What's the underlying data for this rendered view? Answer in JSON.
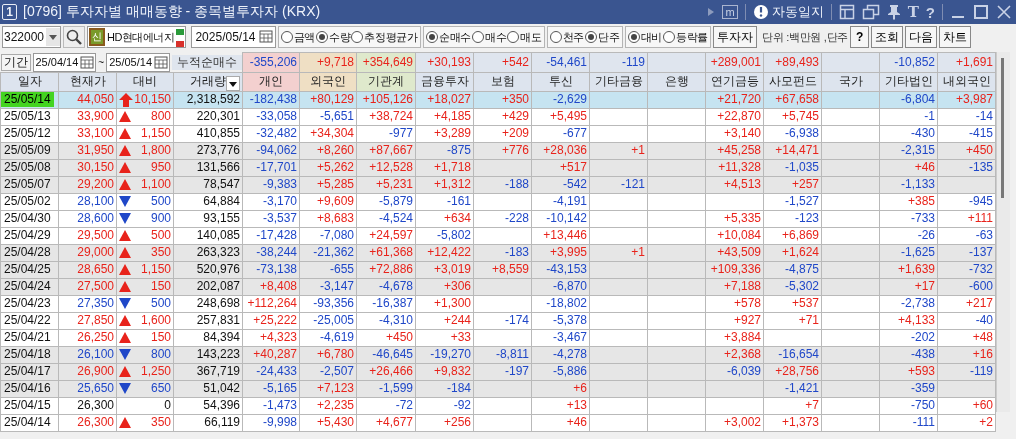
{
  "window": {
    "badge": "1",
    "title": "[0796] 투자자별 매매동향 - 종목별투자자 (KRX)",
    "auto_log": "자동일지",
    "glyphs": [
      "m",
      "T",
      "?"
    ]
  },
  "toolbar": {
    "code": "322000",
    "badge": "신",
    "stock_name": "HD현대에너지",
    "date": "2025/05/14",
    "radio_groups": [
      [
        {
          "label": "금액",
          "selected": false
        },
        {
          "label": "수량",
          "selected": true
        },
        {
          "label": "추정평균가",
          "selected": false
        }
      ],
      [
        {
          "label": "순매수",
          "selected": true
        },
        {
          "label": "매수",
          "selected": false
        },
        {
          "label": "매도",
          "selected": false
        }
      ],
      [
        {
          "label": "천주",
          "selected": false
        },
        {
          "label": "단주",
          "selected": true
        }
      ],
      [
        {
          "label": "대비",
          "selected": true
        },
        {
          "label": "등락률",
          "selected": false
        }
      ]
    ],
    "investor_button": "투자자",
    "unit": "단위 :백만원 ,단주",
    "buttons": [
      "?",
      "조회",
      "다음",
      "차트"
    ]
  },
  "period": {
    "label": "기간",
    "from": "25/04/14",
    "sep": "~",
    "to": "25/05/14",
    "total_label": "누적순매수",
    "totals": {
      "individual": "-355,206",
      "foreign": "+9,718",
      "institutional": "+354,649",
      "fin_invest": "+30,193",
      "insurance": "+542",
      "trust": "-54,461",
      "other_fin": "-119",
      "pension": "+289,001",
      "private_fund": "+89,493",
      "other_corp": "-10,852",
      "other_foreign": "+1,691"
    }
  },
  "table": {
    "columns": [
      {
        "label": "일자",
        "menu": false
      },
      {
        "label": "현재가",
        "menu": false
      },
      {
        "label": "대비",
        "menu": false
      },
      {
        "label": "거래량",
        "menu": true
      },
      {
        "label": "개인",
        "menu": false,
        "color": "#f3d0cf"
      },
      {
        "label": "외국인",
        "menu": false,
        "color": "#efdfc4"
      },
      {
        "label": "기관계",
        "menu": false,
        "color": "#dfe9cc"
      },
      {
        "label": "금융투자",
        "menu": false
      },
      {
        "label": "보험",
        "menu": false
      },
      {
        "label": "투신",
        "menu": false
      },
      {
        "label": "기타금융",
        "menu": false
      },
      {
        "label": "은행",
        "menu": false
      },
      {
        "label": "연기금등",
        "menu": false
      },
      {
        "label": "사모펀드",
        "menu": false
      },
      {
        "label": "국가",
        "menu": false
      },
      {
        "label": "기타법인",
        "menu": false
      },
      {
        "label": "내외국인",
        "menu": false
      }
    ],
    "rows": [
      {
        "selected": true,
        "shaded": false,
        "date": "25/05/14",
        "price": "44,050",
        "kind": "upper",
        "change": "10,150",
        "volume": "2,318,592",
        "individual": "-182,438",
        "foreign": "+80,129",
        "institutional": "+105,126",
        "fin_invest": "+18,027",
        "insurance": "+350",
        "trust": "-2,629",
        "pension": "+21,720",
        "private_fund": "+67,658",
        "other_corp": "-6,804",
        "other_foreign": "+3,987"
      },
      {
        "selected": false,
        "shaded": false,
        "date": "25/05/13",
        "price": "33,900",
        "kind": "up",
        "change": "800",
        "volume": "220,301",
        "individual": "-33,058",
        "foreign": "-5,651",
        "institutional": "+38,724",
        "fin_invest": "+4,185",
        "insurance": "+429",
        "trust": "+5,495",
        "pension": "+22,870",
        "private_fund": "+5,745",
        "other_corp": "-1",
        "other_foreign": "-14"
      },
      {
        "selected": false,
        "shaded": false,
        "date": "25/05/12",
        "price": "33,100",
        "kind": "up",
        "change": "1,150",
        "volume": "410,855",
        "individual": "-32,482",
        "foreign": "+34,304",
        "institutional": "-977",
        "fin_invest": "+3,289",
        "insurance": "+209",
        "trust": "-677",
        "pension": "+3,140",
        "private_fund": "-6,938",
        "other_corp": "-430",
        "other_foreign": "-415"
      },
      {
        "selected": false,
        "shaded": true,
        "date": "25/05/09",
        "price": "31,950",
        "kind": "up",
        "change": "1,800",
        "volume": "273,776",
        "individual": "-94,062",
        "foreign": "+8,260",
        "institutional": "+87,667",
        "fin_invest": "-875",
        "insurance": "+776",
        "trust": "+28,036",
        "other_fin": "+1",
        "pension": "+45,258",
        "private_fund": "+14,471",
        "other_corp": "-2,315",
        "other_foreign": "+450"
      },
      {
        "selected": false,
        "shaded": true,
        "date": "25/05/08",
        "price": "30,150",
        "kind": "up",
        "change": "950",
        "volume": "131,566",
        "individual": "-17,701",
        "foreign": "+5,262",
        "institutional": "+12,528",
        "fin_invest": "+1,718",
        "trust": "+517",
        "pension": "+11,328",
        "private_fund": "-1,035",
        "other_corp": "+46",
        "other_foreign": "-135"
      },
      {
        "selected": false,
        "shaded": true,
        "date": "25/05/07",
        "price": "29,200",
        "kind": "up",
        "change": "1,100",
        "volume": "78,547",
        "individual": "-9,383",
        "foreign": "+5,285",
        "institutional": "+5,231",
        "fin_invest": "+1,312",
        "insurance": "-188",
        "trust": "-542",
        "other_fin": "-121",
        "pension": "+4,513",
        "private_fund": "+257",
        "other_corp": "-1,133"
      },
      {
        "selected": false,
        "shaded": false,
        "date": "25/05/02",
        "price": "28,100",
        "kind": "down",
        "change": "500",
        "volume": "64,884",
        "individual": "-3,170",
        "foreign": "+9,609",
        "institutional": "-5,879",
        "fin_invest": "-161",
        "trust": "-4,191",
        "private_fund": "-1,527",
        "other_corp": "+385",
        "other_foreign": "-945"
      },
      {
        "selected": false,
        "shaded": false,
        "date": "25/04/30",
        "price": "28,600",
        "kind": "down",
        "change": "900",
        "volume": "93,155",
        "individual": "-3,537",
        "foreign": "+8,683",
        "institutional": "-4,524",
        "fin_invest": "+634",
        "insurance": "-228",
        "trust": "-10,142",
        "pension": "+5,335",
        "private_fund": "-123",
        "other_corp": "-733",
        "other_foreign": "+111"
      },
      {
        "selected": false,
        "shaded": false,
        "date": "25/04/29",
        "price": "29,500",
        "kind": "up",
        "change": "500",
        "volume": "140,085",
        "individual": "-17,428",
        "foreign": "-7,080",
        "institutional": "+24,597",
        "fin_invest": "-5,802",
        "trust": "+13,446",
        "pension": "+10,084",
        "private_fund": "+6,869",
        "other_corp": "-26",
        "other_foreign": "-63"
      },
      {
        "selected": false,
        "shaded": true,
        "date": "25/04/28",
        "price": "29,000",
        "kind": "up",
        "change": "350",
        "volume": "263,323",
        "individual": "-38,244",
        "foreign": "-21,362",
        "institutional": "+61,368",
        "fin_invest": "+12,422",
        "insurance": "-183",
        "trust": "+3,995",
        "other_fin": "+1",
        "pension": "+43,509",
        "private_fund": "+1,624",
        "other_corp": "-1,625",
        "other_foreign": "-137"
      },
      {
        "selected": false,
        "shaded": true,
        "date": "25/04/25",
        "price": "28,650",
        "kind": "up",
        "change": "1,150",
        "volume": "520,976",
        "individual": "-73,138",
        "foreign": "-655",
        "institutional": "+72,886",
        "fin_invest": "+3,019",
        "insurance": "+8,559",
        "trust": "-43,153",
        "pension": "+109,336",
        "private_fund": "-4,875",
        "other_corp": "+1,639",
        "other_foreign": "-732"
      },
      {
        "selected": false,
        "shaded": true,
        "date": "25/04/24",
        "price": "27,500",
        "kind": "up",
        "change": "150",
        "volume": "202,087",
        "individual": "+8,408",
        "foreign": "-3,147",
        "institutional": "-4,678",
        "fin_invest": "+306",
        "trust": "-6,870",
        "pension": "+7,188",
        "private_fund": "-5,302",
        "other_corp": "+17",
        "other_foreign": "-600"
      },
      {
        "selected": false,
        "shaded": false,
        "date": "25/04/23",
        "price": "27,350",
        "kind": "down",
        "change": "500",
        "volume": "248,698",
        "individual": "+112,264",
        "foreign": "-93,356",
        "institutional": "-16,387",
        "fin_invest": "+1,300",
        "trust": "-18,802",
        "pension": "+578",
        "private_fund": "+537",
        "other_corp": "-2,738",
        "other_foreign": "+217"
      },
      {
        "selected": false,
        "shaded": false,
        "date": "25/04/22",
        "price": "27,850",
        "kind": "up",
        "change": "1,600",
        "volume": "257,831",
        "individual": "+25,222",
        "foreign": "-25,005",
        "institutional": "-4,310",
        "fin_invest": "+244",
        "insurance": "-174",
        "trust": "-5,378",
        "pension": "+927",
        "private_fund": "+71",
        "other_corp": "+4,133",
        "other_foreign": "-40"
      },
      {
        "selected": false,
        "shaded": false,
        "date": "25/04/21",
        "price": "26,250",
        "kind": "up",
        "change": "150",
        "volume": "84,394",
        "individual": "+4,323",
        "foreign": "-4,619",
        "institutional": "+450",
        "fin_invest": "+33",
        "trust": "-3,467",
        "pension": "+3,884",
        "other_corp": "-202",
        "other_foreign": "+48"
      },
      {
        "selected": false,
        "shaded": true,
        "date": "25/04/18",
        "price": "26,100",
        "kind": "down",
        "change": "800",
        "volume": "143,223",
        "individual": "+40,287",
        "foreign": "+6,780",
        "institutional": "-46,645",
        "fin_invest": "-19,270",
        "insurance": "-8,811",
        "trust": "-4,278",
        "pension": "+2,368",
        "private_fund": "-16,654",
        "other_corp": "-438",
        "other_foreign": "+16"
      },
      {
        "selected": false,
        "shaded": true,
        "date": "25/04/17",
        "price": "26,900",
        "kind": "up",
        "change": "1,250",
        "volume": "367,719",
        "individual": "-24,433",
        "foreign": "-2,507",
        "institutional": "+26,466",
        "fin_invest": "+9,832",
        "insurance": "-197",
        "trust": "-5,886",
        "pension": "-6,039",
        "private_fund": "+28,756",
        "other_corp": "+593",
        "other_foreign": "-119"
      },
      {
        "selected": false,
        "shaded": true,
        "date": "25/04/16",
        "price": "25,650",
        "kind": "down",
        "change": "650",
        "volume": "51,042",
        "individual": "-5,165",
        "foreign": "+7,123",
        "institutional": "-1,599",
        "fin_invest": "-184",
        "trust": "+6",
        "private_fund": "-1,421",
        "other_corp": "-359"
      },
      {
        "selected": false,
        "shaded": false,
        "date": "25/04/15",
        "price": "26,300",
        "kind": "flat",
        "change": "0",
        "volume": "54,396",
        "individual": "-1,473",
        "foreign": "+2,235",
        "institutional": "-72",
        "fin_invest": "-92",
        "trust": "+13",
        "private_fund": "+7",
        "other_corp": "-750",
        "other_foreign": "+60"
      },
      {
        "selected": false,
        "shaded": false,
        "date": "25/04/14",
        "price": "26,300",
        "kind": "up",
        "change": "350",
        "volume": "66,119",
        "individual": "-9,998",
        "foreign": "+5,430",
        "institutional": "+4,677",
        "fin_invest": "+256",
        "trust": "+46",
        "pension": "+3,002",
        "private_fund": "+1,373",
        "other_corp": "-111",
        "other_foreign": "+2"
      }
    ]
  }
}
